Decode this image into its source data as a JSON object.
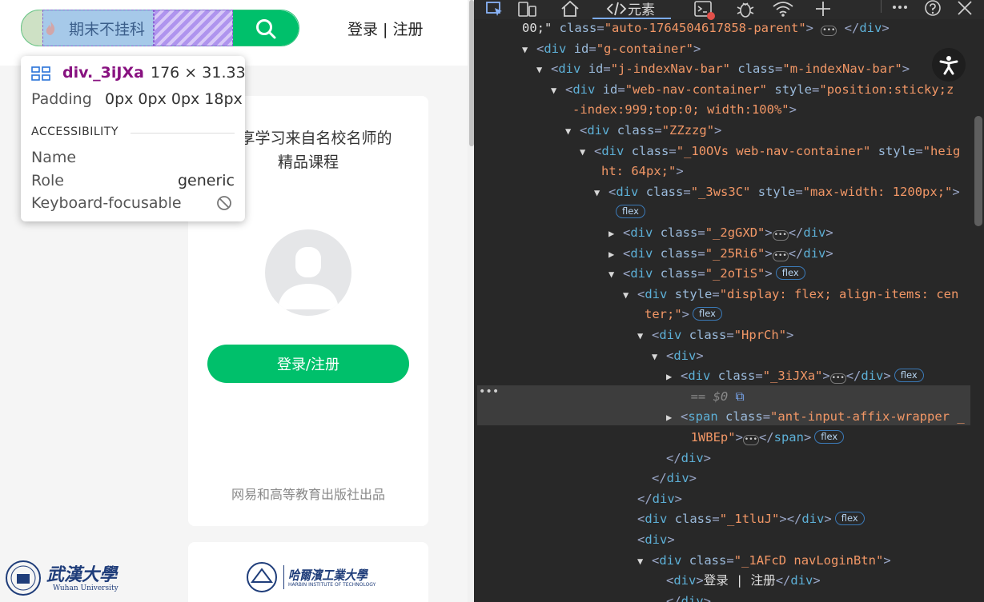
{
  "page": {
    "search": {
      "placeholder": "期末不挂科"
    },
    "header": {
      "login_link": "登录 | 注册"
    },
    "card": {
      "title_line1": "畅享学习来自名校名师的",
      "title_line2": "精品课程",
      "cta_label": "登录/注册",
      "footer": "网易和高等教育出版社出品"
    },
    "partners": [
      {
        "name_cn": "武漢大學",
        "name_en": "Wuhan University"
      },
      {
        "name_cn": "哈爾濱工業大學",
        "name_en": "HARBIN INSTITUTE OF TECHNOLOGY"
      }
    ]
  },
  "tooltip": {
    "class_name": "div._3iJXa",
    "dimensions": "176 × 31.33",
    "padding_label": "Padding",
    "padding_value": "0px 0px 0px 18px",
    "section_title": "ACCESSIBILITY",
    "name_label": "Name",
    "role_label": "Role",
    "role_value": "generic",
    "keyboard_label": "Keyboard-focusable"
  },
  "devtools": {
    "active_tab": "元素",
    "lines": [
      {
        "indent": 0,
        "tri": "",
        "html": "<span class=\"w\">00;\" </span><span class=\"a\">class</span>=<span class=\"v\">\"auto-1764504617858-parent\"</span>&gt; <span class=\"ell\">•••</span> &lt;/<span class=\"t\">div</span>&gt;"
      },
      {
        "indent": 1,
        "tri": "▼",
        "html": "&lt;<span class=\"t\">div</span> <span class=\"a\">id</span>=<span class=\"v\">\"g-container\"</span>&gt;"
      },
      {
        "indent": 2,
        "tri": "▼",
        "html": "&lt;<span class=\"t\">div</span> <span class=\"a\">id</span>=<span class=\"v\">\"j-indexNav-bar\"</span> <span class=\"a\">class</span>=<span class=\"v\">\"m-indexNav-bar\"</span>&gt;"
      },
      {
        "indent": 3,
        "tri": "▼",
        "html": "&lt;<span class=\"t\">div</span> <span class=\"a\">id</span>=<span class=\"v\">\"web-nav-container\"</span> <span class=\"a\">style</span>=<span class=\"v\">\"position:sticky;z</span>"
      },
      {
        "indent": 3.5,
        "tri": "",
        "html": "<span class=\"v\">-index:999;top:0; width:100%\"</span>&gt;"
      },
      {
        "indent": 4,
        "tri": "▼",
        "html": "&lt;<span class=\"t\">div</span> <span class=\"a\">class</span>=<span class=\"v\">\"ZZzzg\"</span>&gt;"
      },
      {
        "indent": 5,
        "tri": "▼",
        "html": "&lt;<span class=\"t\">div</span> <span class=\"a\">class</span>=<span class=\"v\">\"_10OVs web-nav-container\"</span> <span class=\"a\">style</span>=<span class=\"v\">\"heig</span>"
      },
      {
        "indent": 5.5,
        "tri": "",
        "html": "<span class=\"v\">ht: 64px;\"</span>&gt;"
      },
      {
        "indent": 6,
        "tri": "▼",
        "html": "&lt;<span class=\"t\">div</span> <span class=\"a\">class</span>=<span class=\"v\">\"_3ws3C\"</span> <span class=\"a\">style</span>=<span class=\"v\">\"max-width: 1200px;\"</span>&gt;"
      },
      {
        "indent": 6.5,
        "tri": "",
        "html": "<span class=\"badge\" style=\"margin-left:0\">flex</span>"
      },
      {
        "indent": 7,
        "tri": "▶",
        "html": "&lt;<span class=\"t\">div</span> <span class=\"a\">class</span>=<span class=\"v\">\"_2gGXD\"</span>&gt;<span class=\"ell\">•••</span>&lt;/<span class=\"t\">div</span>&gt;"
      },
      {
        "indent": 7,
        "tri": "▶",
        "html": "&lt;<span class=\"t\">div</span> <span class=\"a\">class</span>=<span class=\"v\">\"_25Ri6\"</span>&gt;<span class=\"ell\">•••</span>&lt;/<span class=\"t\">div</span>&gt;"
      },
      {
        "indent": 7,
        "tri": "▼",
        "html": "&lt;<span class=\"t\">div</span> <span class=\"a\">class</span>=<span class=\"v\">\"_2oTiS\"</span>&gt;<span class=\"badge\">flex</span>"
      },
      {
        "indent": 8,
        "tri": "▼",
        "html": "&lt;<span class=\"t\">div</span> <span class=\"a\">style</span>=<span class=\"v\">\"display: flex; align-items: cen</span>"
      },
      {
        "indent": 8.5,
        "tri": "",
        "html": "<span class=\"v\">ter;\"</span>&gt;<span class=\"badge\">flex</span>"
      },
      {
        "indent": 9,
        "tri": "▼",
        "html": "&lt;<span class=\"t\">div</span> <span class=\"a\">class</span>=<span class=\"v\">\"HprCh\"</span>&gt;"
      },
      {
        "indent": 10,
        "tri": "▼",
        "html": "&lt;<span class=\"t\">div</span>&gt;"
      },
      {
        "indent": 11,
        "tri": "▶",
        "html": "&lt;<span class=\"t\">div</span> <span class=\"a\">class</span>=<span class=\"v\">\"_3iJXa\"</span>&gt;<span class=\"ell\">•••</span>&lt;/<span class=\"t\">div</span>&gt;<span class=\"badge\">flex</span>"
      },
      {
        "indent": 11.7,
        "tri": "",
        "html": "<span class=\"dim\">== $0</span> <span style=\"color:#7cacf8\">⧉</span>"
      },
      {
        "indent": 11,
        "tri": "▶",
        "html": "&lt;<span class=\"t\">span</span> <span class=\"a\">class</span>=<span class=\"v\">\"ant-input-affix-wrapper _</span>"
      },
      {
        "indent": 11.7,
        "tri": "",
        "html": "<span class=\"v\">1WBEp\"</span>&gt;<span class=\"ell\">•••</span>&lt;/<span class=\"t\">span</span>&gt;<span class=\"badge\">flex</span>"
      },
      {
        "indent": 10,
        "tri": "",
        "html": "&lt;/<span class=\"t\">div</span>&gt;"
      },
      {
        "indent": 9,
        "tri": "",
        "html": "&lt;/<span class=\"t\">div</span>&gt;"
      },
      {
        "indent": 8,
        "tri": "",
        "html": "&lt;/<span class=\"t\">div</span>&gt;"
      },
      {
        "indent": 8,
        "tri": "",
        "html": "&lt;<span class=\"t\">div</span> <span class=\"a\">class</span>=<span class=\"v\">\"_1tluJ\"</span>&gt;&lt;/<span class=\"t\">div</span>&gt;<span class=\"badge\">flex</span>"
      },
      {
        "indent": 8,
        "tri": "",
        "html": "&lt;<span class=\"t\">div</span>&gt;"
      },
      {
        "indent": 9,
        "tri": "▼",
        "html": "&lt;<span class=\"t\">div</span> <span class=\"a\">class</span>=<span class=\"v\">\"_1AFcD navLoginBtn\"</span>&gt;"
      },
      {
        "indent": 10,
        "tri": "",
        "html": "&lt;<span class=\"t\">div</span>&gt;<span class=\"w\">登录 | 注册</span>&lt;/<span class=\"t\">div</span>&gt;"
      },
      {
        "indent": 10,
        "tri": "",
        "html": "&lt;/<span class=\"t\">div</span>&gt;"
      }
    ]
  },
  "colors": {
    "brand_green": "#00c06b",
    "devtools_bg": "#282828",
    "tag_blue": "#5db0d7",
    "attr_value_orange": "#f29766"
  },
  "icons": [
    "inspect-icon",
    "device-toolbar-icon",
    "home-icon",
    "elements-tab-icon",
    "console-icon",
    "debug-icon",
    "network-icon",
    "add-tab-icon",
    "more-icon",
    "help-icon",
    "close-icon",
    "search-icon",
    "fire-icon",
    "avatar-placeholder-icon",
    "accessibility-icon"
  ]
}
